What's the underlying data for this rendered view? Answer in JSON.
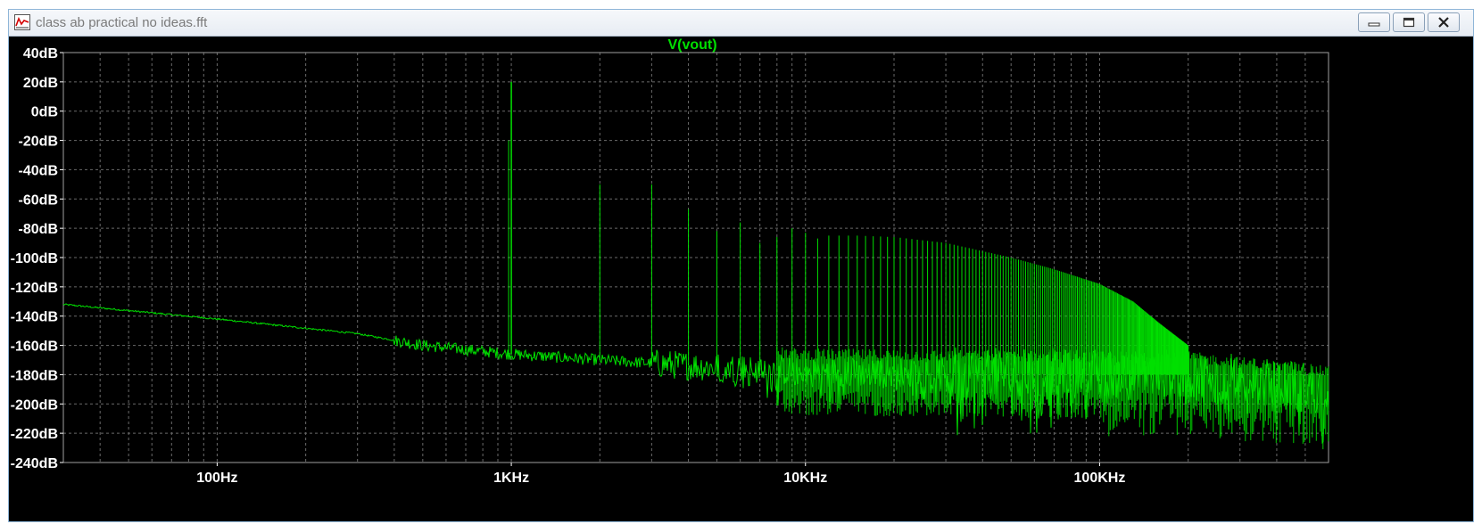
{
  "window": {
    "title": "class ab practical no ideas.fft",
    "icon": "waveform-icon",
    "buttons": [
      "minimize-icon",
      "maximize-icon",
      "close-icon"
    ]
  },
  "colors": {
    "trace": "#00e000",
    "background": "#000000",
    "grid": "#6a6a6a",
    "axis_text": "#ffffff"
  },
  "chart_data": {
    "type": "line",
    "title": "V(vout)",
    "xscale": "log",
    "xlim": [
      30,
      600000
    ],
    "ylim": [
      -240,
      40
    ],
    "x_ticks": [
      "100Hz",
      "1KHz",
      "10KHz",
      "100KHz"
    ],
    "y_ticks": [
      "40dB",
      "20dB",
      "0dB",
      "-20dB",
      "-40dB",
      "-60dB",
      "-80dB",
      "-100dB",
      "-120dB",
      "-140dB",
      "-160dB",
      "-180dB",
      "-200dB",
      "-220dB",
      "-240dB"
    ],
    "grid": true,
    "series": [
      {
        "name": "V(vout)",
        "fundamental": {
          "x": 1000,
          "y": 20
        },
        "harmonics": [
          {
            "x": 2000,
            "y": -50
          },
          {
            "x": 3000,
            "y": -50
          },
          {
            "x": 4000,
            "y": -67
          },
          {
            "x": 5000,
            "y": -82
          },
          {
            "x": 6000,
            "y": -76
          },
          {
            "x": 7000,
            "y": -90
          },
          {
            "x": 8000,
            "y": -86
          },
          {
            "x": 9000,
            "y": -80
          },
          {
            "x": 10000,
            "y": -83
          },
          {
            "x": 11000,
            "y": -87
          },
          {
            "x": 12000,
            "y": -85
          },
          {
            "x": 15000,
            "y": -85
          },
          {
            "x": 20000,
            "y": -86
          },
          {
            "x": 30000,
            "y": -90
          },
          {
            "x": 50000,
            "y": -100
          },
          {
            "x": 70000,
            "y": -108
          },
          {
            "x": 100000,
            "y": -118
          },
          {
            "x": 130000,
            "y": -130
          },
          {
            "x": 160000,
            "y": -145
          },
          {
            "x": 200000,
            "y": -160
          }
        ],
        "noise_floor": [
          {
            "x": 30,
            "y": -132
          },
          {
            "x": 100,
            "y": -142
          },
          {
            "x": 300,
            "y": -152
          },
          {
            "x": 500,
            "y": -160
          },
          {
            "x": 1000,
            "y": -166
          },
          {
            "x": 2000,
            "y": -170
          },
          {
            "x": 5000,
            "y": -175
          },
          {
            "x": 10000,
            "y": -178
          },
          {
            "x": 100000,
            "y": -180
          },
          {
            "x": 200000,
            "y": -180
          },
          {
            "x": 600000,
            "y": -190
          }
        ]
      }
    ]
  }
}
